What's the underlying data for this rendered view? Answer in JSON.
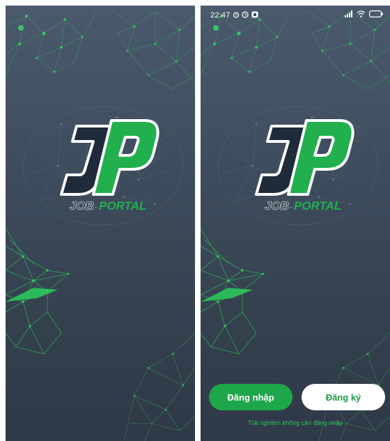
{
  "status": {
    "time": "22:47"
  },
  "brand": {
    "monogram_left": "J",
    "monogram_right": "P",
    "word_left": "JOB",
    "word_right": "PORTAL"
  },
  "actions": {
    "login_label": "Đăng nhập",
    "register_label": "Đăng ký",
    "guest_label": "Trải nghiệm không cần đăng nhập"
  },
  "colors": {
    "accent": "#1ea64b",
    "navy": "#1f2a3a",
    "bg_top": "#4a5a6c",
    "bg_bottom": "#2f3947"
  },
  "icons": [
    "alarm-icon",
    "clock-icon",
    "notification-icon",
    "signal-icon",
    "wifi-icon",
    "battery-icon"
  ]
}
